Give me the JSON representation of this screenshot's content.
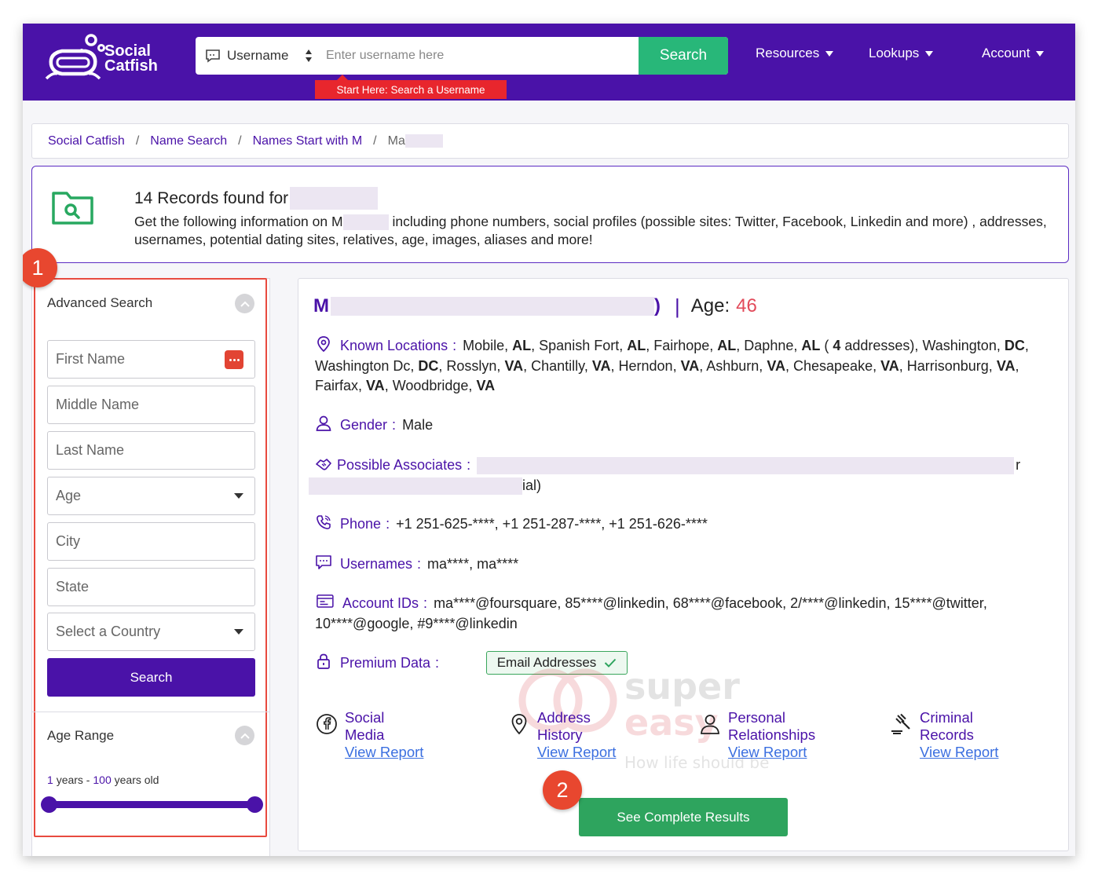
{
  "header": {
    "logo_line1": "Social",
    "logo_line2": "Catfish",
    "search_type": "Username",
    "search_placeholder": "Enter username here",
    "search_button": "Search",
    "hint": "Start Here: Search a Username",
    "nav": [
      "Resources",
      "Lookups",
      "Account"
    ]
  },
  "breadcrumb": {
    "items": [
      "Social Catfish",
      "Name Search",
      "Names Start with M"
    ],
    "current": "Ma",
    "separator": "/"
  },
  "records": {
    "title": "14 Records found for",
    "desc_prefix": "Get the following information on",
    "desc_initial": "M",
    "desc_rest": "including phone numbers, social profiles (possible sites: Twitter, Facebook, Linkedin and more) , addresses, usernames, potential dating sites, relatives, age, images, aliases and more!"
  },
  "sidebar": {
    "badge": "1",
    "advanced_title": "Advanced Search",
    "first_name": "First Name",
    "middle_name": "Middle Name",
    "last_name": "Last Name",
    "age": "Age",
    "city": "City",
    "state": "State",
    "country": "Select a Country",
    "search_button": "Search",
    "age_range_title": "Age Range",
    "range_min": "1",
    "range_mid": "years -",
    "range_max": "100",
    "range_end": "years old",
    "range_values": [
      1,
      100
    ]
  },
  "result": {
    "initial": "M",
    "close_paren": ")",
    "pipe": "|",
    "age_label": "Age:",
    "age": "46",
    "locations_label": "Known Locations",
    "locations": [
      {
        "city": "Mobile",
        "st": "AL"
      },
      {
        "city": "Spanish Fort",
        "st": "AL"
      },
      {
        "city": "Fairhope",
        "st": "AL"
      },
      {
        "city": "Daphne",
        "st": "AL",
        "count": "4",
        "count_suffix": "addresses)"
      },
      {
        "city": "Washington",
        "st": "DC"
      },
      {
        "city": "Washington Dc",
        "st": "DC"
      },
      {
        "city": "Rosslyn",
        "st": "VA"
      },
      {
        "city": "Chantilly",
        "st": "VA"
      },
      {
        "city": "Herndon",
        "st": "VA"
      },
      {
        "city": "Ashburn",
        "st": "VA"
      },
      {
        "city": "Chesapeake",
        "st": "VA"
      },
      {
        "city": "Harrisonburg",
        "st": "VA"
      },
      {
        "city": "Fairfax",
        "st": "VA"
      },
      {
        "city": "Woodbridge",
        "st": "VA"
      }
    ],
    "gender_label": "Gender",
    "gender": "Male",
    "associates_label": "Possible Associates",
    "associates_tail1": "r",
    "associates_tail2": "ial)",
    "phone_label": "Phone",
    "phones": "+1 251-625-****, +1 251-287-****, +1 251-626-****",
    "usernames_label": "Usernames",
    "usernames": "ma****, ma****",
    "accounts_label": "Account IDs",
    "accounts": "ma****@foursquare, 85****@linkedin, 68****@facebook, 2/****@linkedin, 15****@twitter, 10****@google, #9****@linkedin",
    "premium_label": "Premium Data",
    "premium_pill": "Email Addresses",
    "colon": ":",
    "reports": [
      {
        "line1": "Social",
        "line2": "Media",
        "link": "View Report",
        "icon": "facebook-icon"
      },
      {
        "line1": "Address",
        "line2": "History",
        "link": "View Report",
        "icon": "location-pin-icon"
      },
      {
        "line1": "Personal",
        "line2": "Relationships",
        "link": "View Report",
        "icon": "person-icon"
      },
      {
        "line1": "Criminal",
        "line2": "Records",
        "link": "View Report",
        "icon": "gavel-icon"
      }
    ],
    "badge": "2",
    "complete_button": "See Complete Results"
  },
  "watermark": {
    "line1": "super",
    "line2": "easy",
    "tagline": "How life should be"
  },
  "colors": {
    "brand": "#4a12a8",
    "accent_green": "#28b779",
    "badge_red": "#e8472f",
    "age_red": "#e24a5a",
    "link_blue": "#3b6fe0"
  }
}
